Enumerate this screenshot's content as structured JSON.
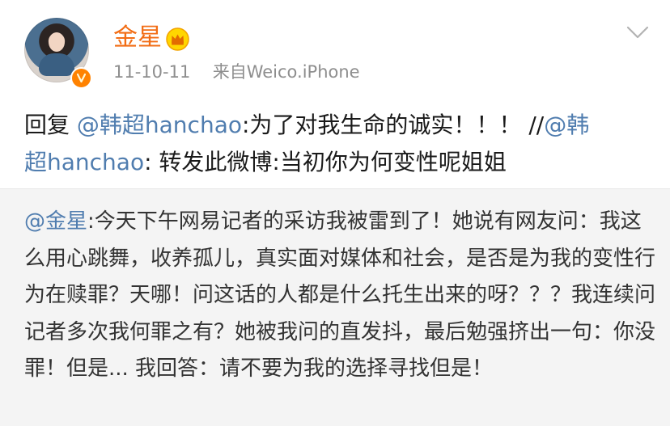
{
  "colors": {
    "name": "#f26d15",
    "mention": "#507daf",
    "meta": "#8e8e8e",
    "repost_bg": "#f4f4f4"
  },
  "header": {
    "user_name": "金星",
    "timestamp": "11-10-11",
    "source": "来自Weico.iPhone",
    "crown_icon": "crown-icon",
    "verify_icon": "verified-badge-icon",
    "menu_icon": "chevron-down-icon"
  },
  "post": {
    "line1_prefix": "回复 ",
    "line1_mention": "@韩超hanchao",
    "line1_text": ":为了对我生命的诚实！！！ //",
    "line1_mention2": "@韩",
    "line2_mention2_cont": "超hanchao",
    "line2_text": ": 转发此微博:当初你为何变性呢姐姐"
  },
  "repost": {
    "mention": "@金星",
    "text": ":今天下午网易记者的采访我被雷到了！她说有网友问：我这么用心跳舞，收养孤儿，真实面对媒体和社会，是否是为我的变性行为在赎罪？天哪！问这话的人都是什么托生出来的呀？？？我连续问记者多次我何罪之有？她被我问的直发抖，最后勉强挤出一句：你没罪！但是... 我回答：请不要为我的选择寻找但是！"
  }
}
